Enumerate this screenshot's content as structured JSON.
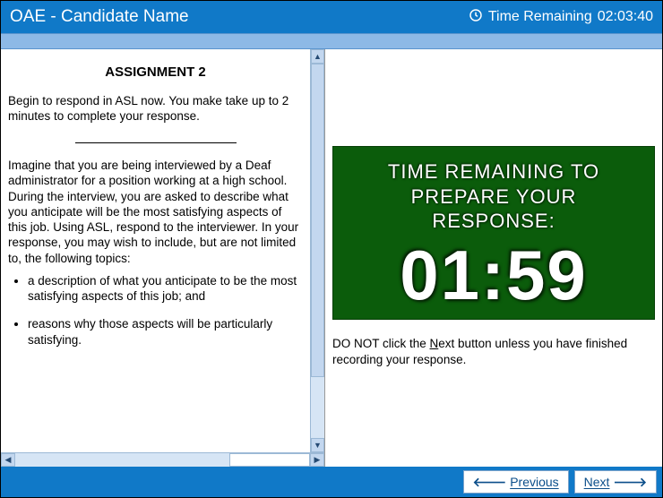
{
  "header": {
    "title": "OAE - Candidate Name",
    "time_label": "Time Remaining ",
    "time_value": "02:03:40"
  },
  "left": {
    "heading": "ASSIGNMENT 2",
    "intro": "Begin to respond in ASL now. You make take up to 2 minutes to complete your response.",
    "scenario": "Imagine that you are being interviewed by a Deaf administrator for a position working at a high school. During the interview, you are asked to describe what you anticipate will be the most satisfying aspects of this job. Using ASL, respond to the interviewer. In your response, you may wish to include, but are not limited to, the following topics:",
    "bullets": [
      "a description of what you anticipate to be the most satisfying aspects of this job; and",
      "reasons why those aspects will be particularly satisfying."
    ]
  },
  "right": {
    "timer_label_line1": "TIME REMAINING TO",
    "timer_label_line2": "PREPARE YOUR",
    "timer_label_line3": "RESPONSE:",
    "timer_value": "01:59",
    "warning_prefix": "DO NOT click the ",
    "warning_next": "N",
    "warning_next_rest": "ext",
    "warning_suffix": " button unless you have finished recording your response."
  },
  "footer": {
    "previous_label": "Previous",
    "next_label": "Next"
  }
}
